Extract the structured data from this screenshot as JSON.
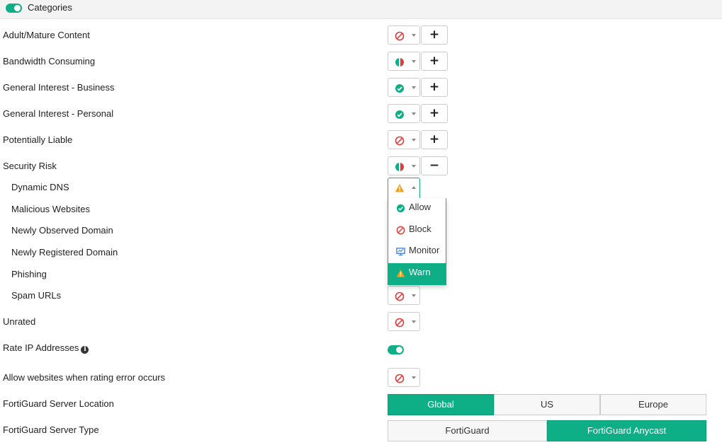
{
  "header": {
    "title": "Categories",
    "toggle_state": "on"
  },
  "colors": {
    "accent": "#0eaf86",
    "block": "#e03c3c",
    "warn": "#f0a020",
    "monitor": "#3a7bd5"
  },
  "categories": [
    {
      "label": "Adult/Mature Content",
      "action_icon": "block-icon",
      "expand": "+"
    },
    {
      "label": "Bandwidth Consuming",
      "action_icon": "mixed-icon",
      "expand": "+"
    },
    {
      "label": "General Interest - Business",
      "action_icon": "allow-icon",
      "expand": "+"
    },
    {
      "label": "General Interest - Personal",
      "action_icon": "allow-icon",
      "expand": "+"
    },
    {
      "label": "Potentially Liable",
      "action_icon": "block-icon",
      "expand": "+"
    },
    {
      "label": "Security Risk",
      "action_icon": "mixed-icon",
      "expand": "−"
    }
  ],
  "subcategories": [
    {
      "label": "Dynamic DNS",
      "action_icon": "warn-icon"
    },
    {
      "label": "Malicious Websites"
    },
    {
      "label": "Newly Observed Domain"
    },
    {
      "label": "Newly Registered Domain"
    },
    {
      "label": "Phishing"
    },
    {
      "label": "Spam URLs",
      "action_icon": "block-icon"
    }
  ],
  "action_menu": {
    "options": [
      {
        "label": "Allow",
        "icon": "allow-icon"
      },
      {
        "label": "Block",
        "icon": "block-icon"
      },
      {
        "label": "Monitor",
        "icon": "monitor-icon"
      },
      {
        "label": "Warn",
        "icon": "warn-icon"
      }
    ],
    "selected": "Warn"
  },
  "unrated": {
    "label": "Unrated",
    "action_icon": "block-icon"
  },
  "rate_ip": {
    "label": "Rate IP Addresses",
    "toggle_state": "on"
  },
  "rating_error": {
    "label": "Allow websites when rating error occurs",
    "action_icon": "block-icon"
  },
  "server_location": {
    "label": "FortiGuard Server Location",
    "options": [
      "Global",
      "US",
      "Europe"
    ],
    "selected": "Global"
  },
  "server_type": {
    "label": "FortiGuard Server Type",
    "options": [
      "FortiGuard",
      "FortiGuard Anycast"
    ],
    "selected": "FortiGuard Anycast"
  }
}
